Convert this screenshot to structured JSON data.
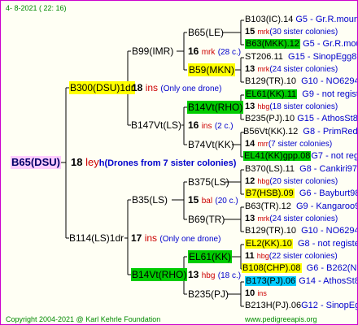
{
  "header": {
    "date": "4-  8-2021 (  22:  16)"
  },
  "footer": {
    "left": "Copyright 2004-2021 @ Karl Kehrle Foundation",
    "right": "www.pedigreeapis.org"
  },
  "root": {
    "name": "B65(DSU)",
    "num": "18",
    "code": "ley",
    "note": "h(Drones from 7 sister colonies)"
  },
  "g1": [
    {
      "name": "B300(DSU)1dr",
      "num": "18",
      "code": "ins",
      "note": "(Only one drone)"
    },
    {
      "name": "B114(LS)1dr",
      "num": "17",
      "code": "ins",
      "note": "(Only one drone)"
    }
  ],
  "g2": [
    {
      "name": "B99(IMR)",
      "num": "16",
      "code": "mrk",
      "note": "(28 c.)"
    },
    {
      "name": "B147Vt(LS)",
      "num": "16",
      "code": "ins",
      "note": "(2 c.)"
    },
    {
      "name": "B35(LS)",
      "num": "15",
      "code": "bal",
      "note": "(20 c.)"
    },
    {
      "name": "B14Vt(RHO)",
      "num": "13",
      "code": "hbg",
      "note": "(18 c.)"
    }
  ],
  "g3": [
    {
      "name": "B65(LE)"
    },
    {
      "name": "B59(MKN)"
    },
    {
      "name": "B14Vt(RHO)"
    },
    {
      "name": "B74Vt(KK)"
    },
    {
      "name": "B375(LS)"
    },
    {
      "name": "B69(TR)"
    },
    {
      "name": "EL61(KK)"
    },
    {
      "name": "B235(PJ)"
    }
  ],
  "g4": [
    {
      "name": "B103(IC).14",
      "info": "G5 - Gr.R.mounta"
    },
    {
      "num": "15",
      "code": "mrk",
      "note": "(30 sister colonies)"
    },
    {
      "name": "B63(MKK).12",
      "info": "G5 - Gr.R.mounta"
    },
    {
      "name": "ST206.11",
      "info": "G15 - SinopEgg86R"
    },
    {
      "num": "13",
      "code": "mrk",
      "note": "(24 sister colonies)"
    },
    {
      "name": "B129(TR).10",
      "info": "G10 - NO6294R"
    },
    {
      "name": "EL61(KK).11",
      "info": "G9 - not registe"
    },
    {
      "num": "13",
      "code": "hbg",
      "note": "(18 sister colonies)"
    },
    {
      "name": "B235(PJ).10",
      "info": "G15 - AthosSt80R"
    },
    {
      "name": "B56Vt(KK).12",
      "info": "G8 - PrimRed01"
    },
    {
      "num": "14",
      "code": "mrr",
      "note": "(7 sister colonies)"
    },
    {
      "name": "EL41(KK)gpp.08",
      "info": "G7 - not registe"
    },
    {
      "name": "B370(LS).11",
      "info": "G8 - Cankiri97Q"
    },
    {
      "num": "12",
      "code": "hbg",
      "note": "(20 sister colonies)"
    },
    {
      "name": "B7(HSB).09",
      "info": "G6 - Bayburt98-3"
    },
    {
      "name": "B63(TR).12",
      "info": "G9 - Kangaroo98R"
    },
    {
      "num": "13",
      "code": "mrk",
      "note": "(24 sister colonies)"
    },
    {
      "name": "B129(TR).10",
      "info": "G10 - NO6294R"
    },
    {
      "name": "EL2(KK).10",
      "info": "G8 - not registe"
    },
    {
      "num": "11",
      "code": "hbg",
      "note": "(22 sister colonies)"
    },
    {
      "name": "B108(CHP).08",
      "info": "G6 - B262(NE)"
    },
    {
      "name": "B173(PJ).06",
      "info": "G14 - AthosSt80R"
    },
    {
      "num": "10",
      "code": "ins",
      "note": ""
    },
    {
      "name": "B213H(PJ).06",
      "info": "G12 - SinopEgg86R"
    }
  ]
}
